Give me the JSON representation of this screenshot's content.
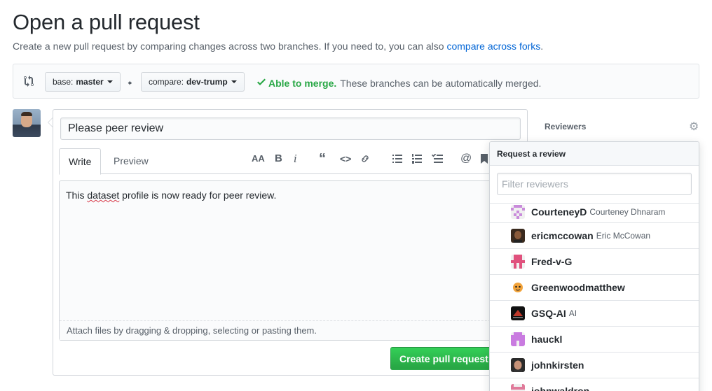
{
  "page": {
    "title": "Open a pull request",
    "subtitle_text": "Create a new pull request by comparing changes across two branches. If you need to, you can also ",
    "subtitle_link": "compare across forks",
    "subtitle_end": "."
  },
  "range": {
    "base_label": "base:",
    "base_branch": "master",
    "compare_label": "compare:",
    "compare_branch": "dev-trump",
    "merge_ok": "Able to merge.",
    "merge_text": "These branches can be automatically merged."
  },
  "form": {
    "title_value": "Please peer review",
    "tabs": [
      "Write",
      "Preview"
    ],
    "body_before": "This ",
    "body_misspelled": "dataset",
    "body_after": " profile is now ready for peer review.",
    "drag_hint": "Attach files by dragging & dropping, selecting or pasting them.",
    "create_button": "Create pull request"
  },
  "toolbar": {
    "icons": [
      "text-size-icon",
      "bold-icon",
      "italic-icon",
      "quote-icon",
      "code-icon",
      "link-icon",
      "bulleted-list-icon",
      "numbered-list-icon",
      "task-list-icon",
      "mention-icon",
      "bookmark-icon"
    ]
  },
  "sidebar": {
    "reviewers_heading": "Reviewers"
  },
  "reviewer_dropdown": {
    "header": "Request a review",
    "filter_placeholder": "Filter reviewers",
    "items": [
      {
        "login": "CourteneyD",
        "name": "Courteney Dhnaram"
      },
      {
        "login": "ericmccowan",
        "name": "Eric McCowan"
      },
      {
        "login": "Fred-v-G",
        "name": ""
      },
      {
        "login": "Greenwoodmatthew",
        "name": ""
      },
      {
        "login": "GSQ-AI",
        "name": "AI"
      },
      {
        "login": "hauckl",
        "name": ""
      },
      {
        "login": "johnkirsten",
        "name": ""
      },
      {
        "login": "johnwaldron",
        "name": ""
      }
    ]
  },
  "colors": {
    "accent_green": "#28a745",
    "link_blue": "#0366d6"
  }
}
